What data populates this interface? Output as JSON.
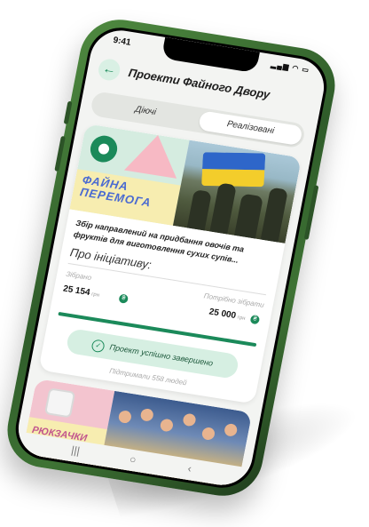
{
  "status": {
    "time": "9:41",
    "icons": "▂▄▆ ◠ ▭"
  },
  "header": {
    "back_icon": "arrow-left-icon",
    "title": "Проекти Файного Двору"
  },
  "tabs": [
    {
      "label": "Діючі"
    },
    {
      "label": "Реалізовані"
    }
  ],
  "project": {
    "banner_text": "ФАЙНА\nПЕРЕМОГА",
    "description": "Збір направлений на придбання овочів та фруктів для виготовлення сухих супів...",
    "about_label": "Про ініціативу:",
    "raised_label": "Зібрано",
    "raised_value": "25 154",
    "needed_label": "Потрібно зібрати",
    "needed_value": "25 000",
    "currency": "грн",
    "coin_symbol": "₴",
    "progress": 1.0,
    "status_button": "Проект успішно завершено",
    "supported_text": "Підтримали 558 людей"
  },
  "project2": {
    "banner_text": "РЮКЗАЧКИ\nПІДТРИМКИ"
  },
  "nav": {
    "recent": "|||",
    "home": "○",
    "back": "‹"
  },
  "colors": {
    "accent": "#1b8a5a",
    "frame": "#3e7334",
    "banner_blue": "#4a6ad1",
    "banner_pink": "#c2568e"
  }
}
